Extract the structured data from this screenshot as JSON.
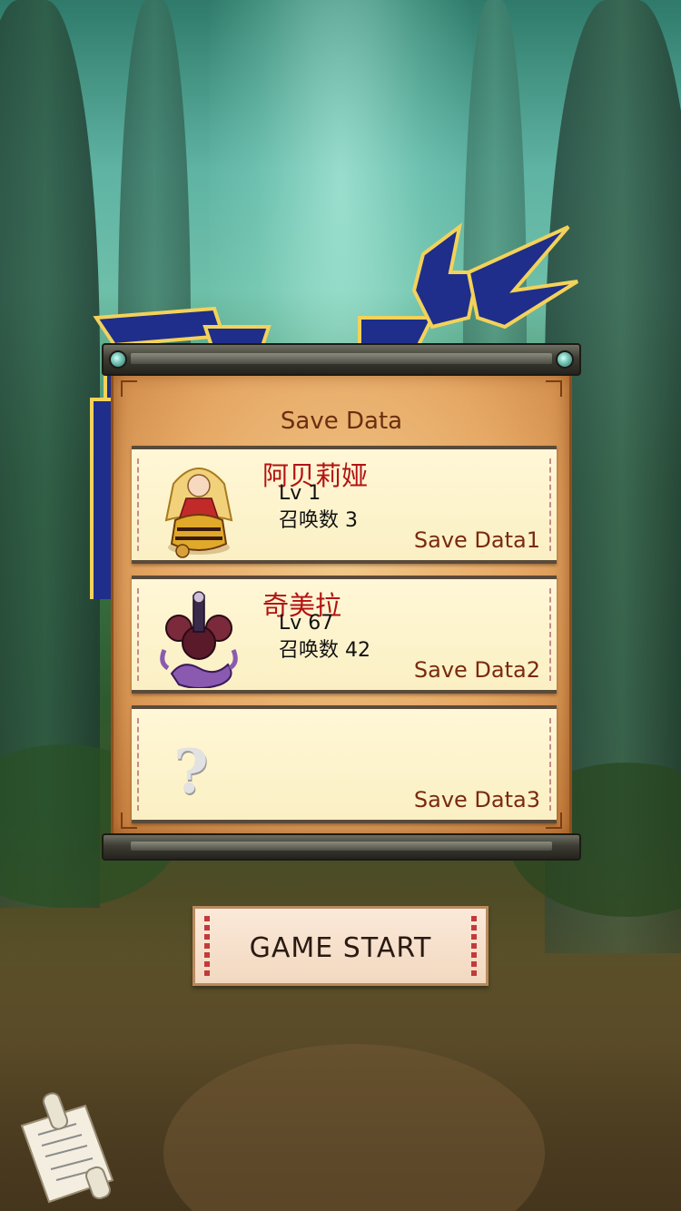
{
  "panel": {
    "title": "Save Data"
  },
  "slots": [
    {
      "name": "阿贝莉娅",
      "level": "Lv  1",
      "summons": "召唤数  3",
      "label": "Save Data1",
      "portrait": "golden-haired-heroine"
    },
    {
      "name": "奇美拉",
      "level": "Lv  67",
      "summons": "召唤数  42",
      "label": "Save Data2",
      "portrait": "chimera-beast"
    },
    {
      "empty_mark": "?",
      "label": "Save Data3"
    }
  ],
  "start_button": {
    "label": "GAME  START"
  },
  "icons": {
    "menu": "scroll-icon"
  },
  "colors": {
    "name_red": "#b31212",
    "panel_text": "#6b2e10",
    "logo_blue": "#1e2e8a"
  }
}
